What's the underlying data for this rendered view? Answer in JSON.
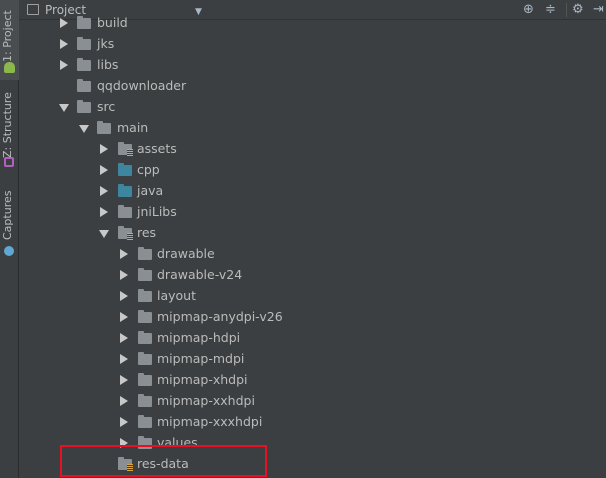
{
  "toolbar": {
    "title": "Project",
    "icons": [
      "project-view-icon",
      "dropdown-arrow-icon",
      "target-icon",
      "collapse-icon",
      "settings-icon",
      "hide-icon"
    ]
  },
  "sidebar": {
    "tabs": [
      {
        "label": "1: Project",
        "active": true
      },
      {
        "label": "Z: Structure",
        "active": false
      },
      {
        "label": "Captures",
        "active": false
      }
    ]
  },
  "tree": {
    "items": [
      {
        "label": "build",
        "state": "collapsed",
        "folder": "gray",
        "depth": 0
      },
      {
        "label": "jks",
        "state": "collapsed",
        "folder": "gray",
        "depth": 0
      },
      {
        "label": "libs",
        "state": "collapsed",
        "folder": "gray",
        "depth": 0
      },
      {
        "label": "qqdownloader",
        "state": "leaf",
        "folder": "gray",
        "depth": 0
      },
      {
        "label": "src",
        "state": "expanded",
        "folder": "gray",
        "depth": 0
      },
      {
        "label": "main",
        "state": "expanded",
        "folder": "gray",
        "depth": 1
      },
      {
        "label": "assets",
        "state": "collapsed",
        "folder": "res",
        "depth": 2
      },
      {
        "label": "cpp",
        "state": "collapsed",
        "folder": "blue",
        "depth": 2
      },
      {
        "label": "java",
        "state": "collapsed",
        "folder": "blue",
        "depth": 2
      },
      {
        "label": "jniLibs",
        "state": "collapsed",
        "folder": "gray",
        "depth": 2
      },
      {
        "label": "res",
        "state": "expanded",
        "folder": "res",
        "depth": 2
      },
      {
        "label": "drawable",
        "state": "collapsed",
        "folder": "gray",
        "depth": 3
      },
      {
        "label": "drawable-v24",
        "state": "collapsed",
        "folder": "gray",
        "depth": 3
      },
      {
        "label": "layout",
        "state": "collapsed",
        "folder": "gray",
        "depth": 3
      },
      {
        "label": "mipmap-anydpi-v26",
        "state": "collapsed",
        "folder": "gray",
        "depth": 3
      },
      {
        "label": "mipmap-hdpi",
        "state": "collapsed",
        "folder": "gray",
        "depth": 3
      },
      {
        "label": "mipmap-mdpi",
        "state": "collapsed",
        "folder": "gray",
        "depth": 3
      },
      {
        "label": "mipmap-xhdpi",
        "state": "collapsed",
        "folder": "gray",
        "depth": 3
      },
      {
        "label": "mipmap-xxhdpi",
        "state": "collapsed",
        "folder": "gray",
        "depth": 3
      },
      {
        "label": "mipmap-xxxhdpi",
        "state": "collapsed",
        "folder": "gray",
        "depth": 3
      },
      {
        "label": "values",
        "state": "collapsed",
        "folder": "gray",
        "depth": 3
      },
      {
        "label": "res-data",
        "state": "leaf",
        "folder": "res",
        "depth": 2
      }
    ]
  },
  "annotation": {
    "color": "#e81123"
  }
}
